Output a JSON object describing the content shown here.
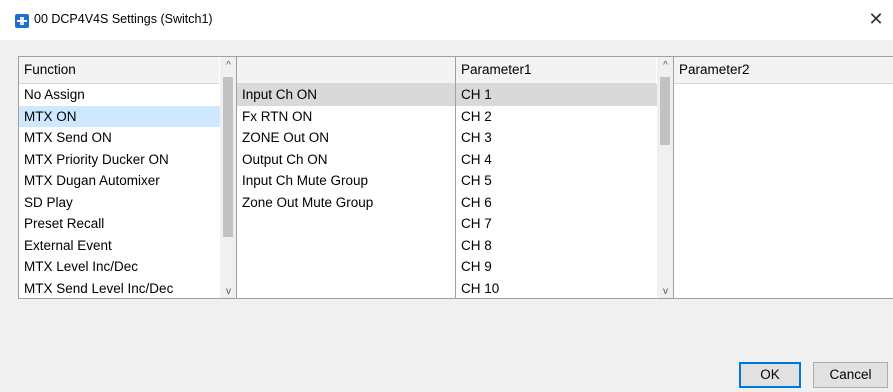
{
  "window": {
    "title": "00 DCP4V4S Settings (Switch1)",
    "close_glyph": "✕"
  },
  "function_list": {
    "header": "Function",
    "items": [
      "No Assign",
      "MTX ON",
      "MTX Send ON",
      "MTX Priority Ducker ON",
      "MTX Dugan Automixer",
      "SD Play",
      "Preset Recall",
      "External Event",
      "MTX Level Inc/Dec",
      "MTX Send Level Inc/Dec"
    ],
    "selected": "MTX ON"
  },
  "sub_function_list": {
    "header": "",
    "items": [
      "Input Ch ON",
      "Fx RTN ON",
      "ZONE Out ON",
      "Output Ch ON",
      "Input Ch Mute Group",
      "Zone Out Mute Group"
    ],
    "selected": "Input Ch ON"
  },
  "parameter1": {
    "header": "Parameter1",
    "items": [
      "CH 1",
      "CH 2",
      "CH 3",
      "CH 4",
      "CH 5",
      "CH 6",
      "CH 7",
      "CH 8",
      "CH 9",
      "CH 10"
    ],
    "selected": "CH 1"
  },
  "parameter2": {
    "header": "Parameter2",
    "items": []
  },
  "scroll_glyphs": {
    "up": "^",
    "down": "v"
  },
  "buttons": {
    "ok": "OK",
    "cancel": "Cancel"
  },
  "colors": {
    "selection_focus": "#cde8ff",
    "selection_inactive": "#d9d9d9",
    "accent": "#0078d7"
  },
  "icons": {
    "app": "dcp-app-icon",
    "close": "close-icon"
  }
}
